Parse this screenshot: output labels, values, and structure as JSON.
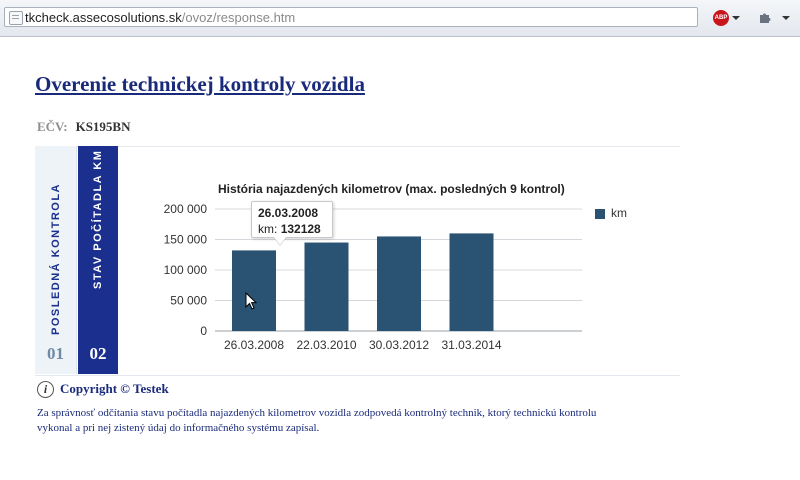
{
  "browser": {
    "url_host": "tkcheck.assecosolutions.sk",
    "url_path": "/ovoz/response.htm",
    "abp_label": "ABP",
    "icons": [
      "page-icon",
      "adblock-icon",
      "puzzle-icon",
      "chevron-down-icon"
    ]
  },
  "page": {
    "title": "Overenie technickej kontroly vozidla",
    "ecv_label": "EČV:",
    "ecv_value": "KS195BN"
  },
  "tabs": [
    {
      "label": "POSLEDNÁ KONTROLA",
      "number": "01"
    },
    {
      "label": "STAV POČÍTADLA KM",
      "number": "02"
    }
  ],
  "chart_data": {
    "type": "bar",
    "title": "História najazdených kilometrov (max. posledných 9 kontrol)",
    "categories": [
      "26.03.2008",
      "22.03.2010",
      "30.03.2012",
      "31.03.2014"
    ],
    "series": [
      {
        "name": "km",
        "values": [
          132128,
          145000,
          155000,
          160000
        ],
        "color": "#2a5272"
      }
    ],
    "y_ticks": [
      "0",
      "50 000",
      "100 000",
      "150 000",
      "200 000"
    ],
    "ylim": [
      0,
      200000
    ],
    "grid": true,
    "legend": "right",
    "tooltip": {
      "date": "26.03.2008",
      "label": "km:",
      "value": "132128"
    }
  },
  "footer": {
    "copyright": "Copyright © Testek",
    "note": "Za správnosť odčítania stavu počítadla najazdených kilometrov vozidla zodpovedá kontrolný technik, ktorý technickú kontrolu vykonal a pri nej zistený údaj do informačného systému zapísal."
  }
}
